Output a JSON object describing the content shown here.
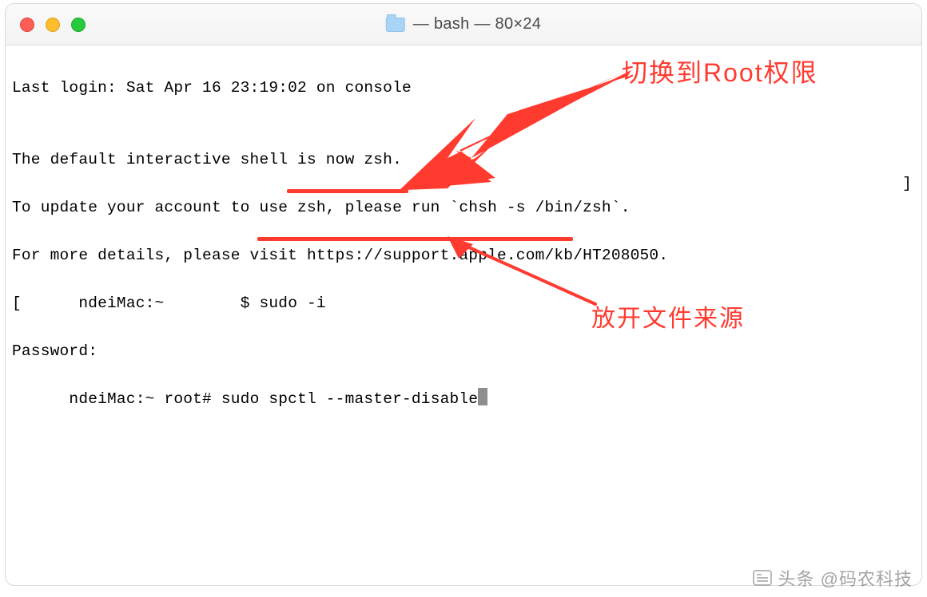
{
  "window": {
    "title": "— bash — 80×24"
  },
  "terminal": {
    "lines": {
      "last_login": "Last login: Sat Apr 16 23:19:02 on console",
      "blank": "",
      "zsh_msg1": "The default interactive shell is now zsh.",
      "zsh_msg2_a": "To update your account to use zsh, please run `chsh -s /bin/zsh`.",
      "zsh_msg3": "For more details, please visit https://support.apple.com/kb/HT208050.",
      "prompt1_pre": "[",
      "prompt1_host": "ndeiMac:~ ",
      "prompt1_end": "$ ",
      "prompt1_cmd": "sudo -i",
      "password": "Password:",
      "prompt2_host": "ndeiMac:~ root# ",
      "prompt2_cmd": "sudo spctl --master-disable"
    }
  },
  "annotations": {
    "top": "切换到Root权限",
    "bottom": "放开文件来源"
  },
  "watermark": {
    "text": "头条 @码农科技"
  },
  "colors": {
    "annotation": "#ff3b30"
  }
}
